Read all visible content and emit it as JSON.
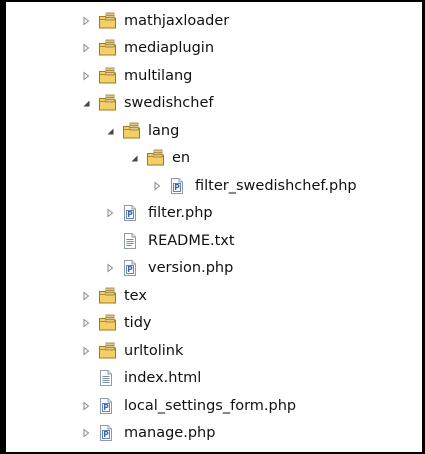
{
  "tree": {
    "items": [
      {
        "label": "mathjaxloader",
        "type": "package",
        "expanded": false
      },
      {
        "label": "mediaplugin",
        "type": "package",
        "expanded": false
      },
      {
        "label": "multilang",
        "type": "package",
        "expanded": false
      },
      {
        "label": "swedishchef",
        "type": "package",
        "expanded": true
      },
      {
        "label": "lang",
        "type": "package",
        "expanded": true
      },
      {
        "label": "en",
        "type": "package",
        "expanded": true
      },
      {
        "label": "filter_swedishchef.php",
        "type": "php",
        "expanded": false
      },
      {
        "label": "filter.php",
        "type": "php",
        "expanded": false
      },
      {
        "label": "README.txt",
        "type": "text",
        "expanded": null
      },
      {
        "label": "version.php",
        "type": "php",
        "expanded": false
      },
      {
        "label": "tex",
        "type": "package",
        "expanded": false
      },
      {
        "label": "tidy",
        "type": "package",
        "expanded": false
      },
      {
        "label": "urltolink",
        "type": "package",
        "expanded": false
      },
      {
        "label": "index.html",
        "type": "html",
        "expanded": null
      },
      {
        "label": "local_settings_form.php",
        "type": "php",
        "expanded": false
      },
      {
        "label": "manage.php",
        "type": "php",
        "expanded": false
      }
    ]
  },
  "icons": {
    "package": "package-folder-icon",
    "php": "php-file-icon",
    "text": "text-file-icon",
    "html": "html-file-icon",
    "collapsed": "chevron-right-icon",
    "expanded": "chevron-down-icon"
  },
  "colors": {
    "folder_fill": "#f3d067",
    "folder_stroke": "#a07a1e",
    "php_accent": "#3a63b8",
    "arrow": "#8a8a8a",
    "arrow_expanded": "#444444"
  }
}
